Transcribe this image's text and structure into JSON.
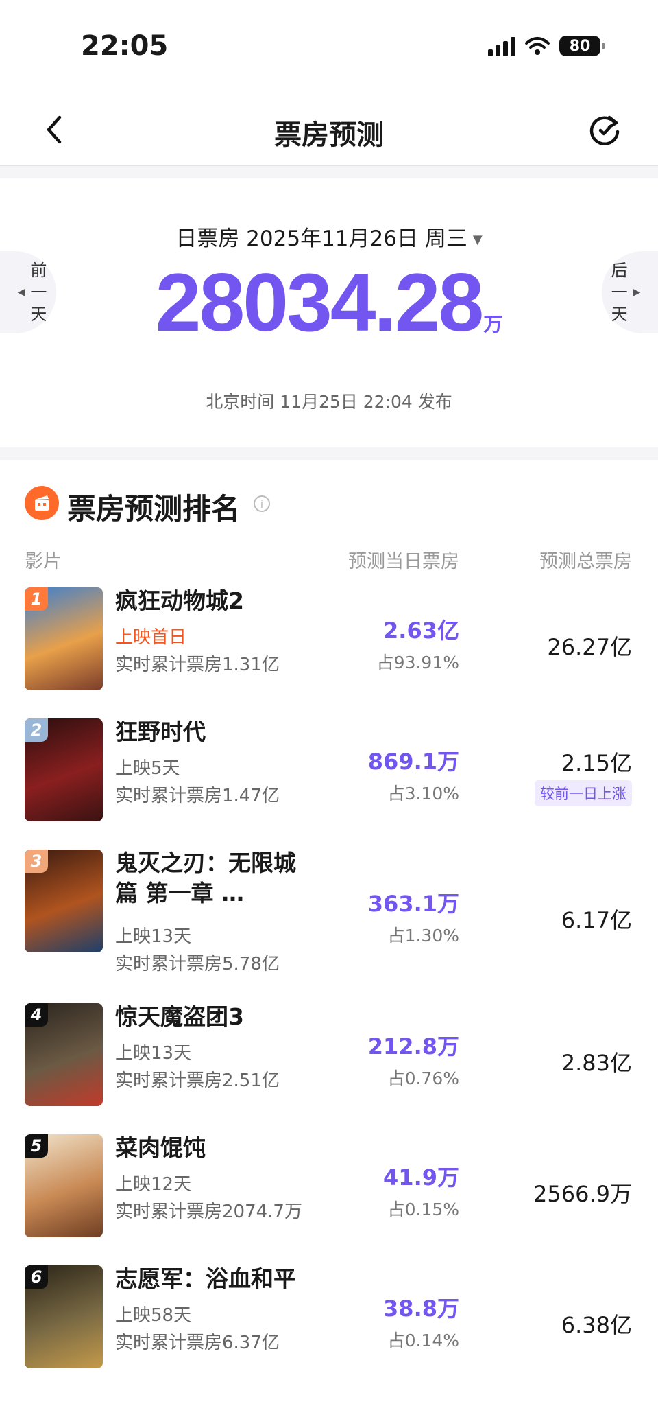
{
  "status_bar": {
    "time": "22:05",
    "battery": "80"
  },
  "nav": {
    "title": "票房预测"
  },
  "summary": {
    "date_label": "日票房 2025年11月26日 周三",
    "total": "28034.28",
    "unit": "万",
    "publish_text": "北京时间 11月25日 22:04 发布",
    "prev_day": [
      "前",
      "一",
      "天"
    ],
    "next_day": [
      "后",
      "一",
      "天"
    ]
  },
  "ranking": {
    "title": "票房预测排名",
    "columns": {
      "film": "影片",
      "predicted_daily": "预测当日票房",
      "predicted_total": "预测总票房"
    },
    "movies": [
      {
        "rank": "1",
        "title": "疯狂动物城2",
        "release": "上映首日",
        "release_hot": true,
        "cumulative": "实时累计票房1.31亿",
        "predicted_daily": "2.63亿",
        "share": "占93.91%",
        "predicted_total": "26.27亿",
        "tag": "",
        "badge_color": "#ff7a3a",
        "poster_colors": [
          "#3c7fd0",
          "#e8a04a",
          "#7a3c2a"
        ]
      },
      {
        "rank": "2",
        "title": "狂野时代",
        "release": "上映5天",
        "release_hot": false,
        "cumulative": "实时累计票房1.47亿",
        "predicted_daily": "869.1万",
        "share": "占3.10%",
        "predicted_total": "2.15亿",
        "tag": "较前一日上涨",
        "badge_color": "#9ab6d6",
        "poster_colors": [
          "#2a0e0e",
          "#8a1f1f",
          "#3a1212"
        ]
      },
      {
        "rank": "3",
        "title": "鬼灭之刃：无限城篇 第一章 …",
        "release": "上映13天",
        "release_hot": false,
        "cumulative": "实时累计票房5.78亿",
        "predicted_daily": "363.1万",
        "share": "占1.30%",
        "predicted_total": "6.17亿",
        "tag": "",
        "badge_color": "#f2a77a",
        "poster_colors": [
          "#3a1a10",
          "#b0541f",
          "#1d3f6a"
        ]
      },
      {
        "rank": "4",
        "title": "惊天魔盗团3",
        "release": "上映13天",
        "release_hot": false,
        "cumulative": "实时累计票房2.51亿",
        "predicted_daily": "212.8万",
        "share": "占0.76%",
        "predicted_total": "2.83亿",
        "tag": "",
        "badge_color": "#111111",
        "poster_colors": [
          "#2a241e",
          "#6b5a44",
          "#c23a2a"
        ]
      },
      {
        "rank": "5",
        "title": "菜肉馄饨",
        "release": "上映12天",
        "release_hot": false,
        "cumulative": "实时累计票房2074.7万",
        "predicted_daily": "41.9万",
        "share": "占0.15%",
        "predicted_total": "2566.9万",
        "tag": "",
        "badge_color": "#111111",
        "poster_colors": [
          "#f1e4cc",
          "#c98a55",
          "#6e3d22"
        ]
      },
      {
        "rank": "6",
        "title": "志愿军：浴血和平",
        "release": "上映58天",
        "release_hot": false,
        "cumulative": "实时累计票房6.37亿",
        "predicted_daily": "38.8万",
        "share": "占0.14%",
        "predicted_total": "6.38亿",
        "tag": "",
        "badge_color": "#111111",
        "poster_colors": [
          "#2a2418",
          "#7a6a44",
          "#c49a4a"
        ]
      }
    ]
  },
  "icons": {
    "back": "chevron-left-icon",
    "refresh": "refresh-icon",
    "rank_logo": "film-ticket-icon",
    "info": "info-icon"
  }
}
